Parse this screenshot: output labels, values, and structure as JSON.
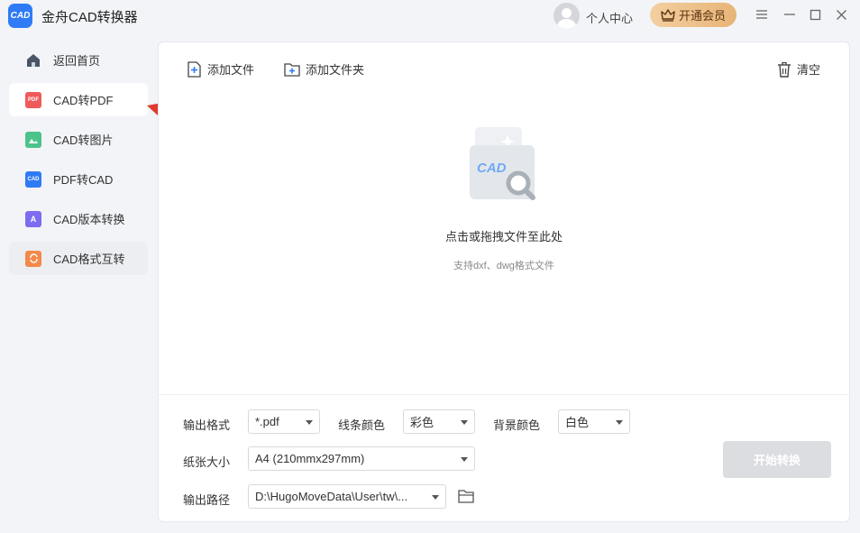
{
  "app": {
    "title": "金舟CAD转换器",
    "logo_text": "CAD"
  },
  "header": {
    "user_center": "个人中心",
    "vip_button": "开通会员"
  },
  "sidebar": {
    "items": [
      {
        "label": "返回首页",
        "icon": "home-icon"
      },
      {
        "label": "CAD转PDF",
        "icon": "pdf-file-icon",
        "badge": "PDF"
      },
      {
        "label": "CAD转图片",
        "icon": "image-file-icon"
      },
      {
        "label": "PDF转CAD",
        "icon": "cad-file-icon",
        "badge": "CAD"
      },
      {
        "label": "CAD版本转换",
        "icon": "version-file-icon",
        "badge": "A"
      },
      {
        "label": "CAD格式互转",
        "icon": "format-file-icon"
      }
    ]
  },
  "toolbar": {
    "add_file": "添加文件",
    "add_folder": "添加文件夹",
    "clear": "清空"
  },
  "drop": {
    "title": "点击或拖拽文件至此处",
    "subtitle": "支持dxf、dwg格式文件",
    "illus_text": "CAD"
  },
  "settings": {
    "output_format_label": "输出格式",
    "output_format_value": "*.pdf",
    "line_color_label": "线条颜色",
    "line_color_value": "彩色",
    "bg_color_label": "背景颜色",
    "bg_color_value": "白色",
    "paper_size_label": "纸张大小",
    "paper_size_value": "A4 (210mmx297mm)",
    "output_path_label": "输出路径",
    "output_path_value": "D:\\HugoMoveData\\User\\tw\\...",
    "start_button": "开始转换"
  },
  "colors": {
    "accent": "#2f7bf5",
    "arrow": "#e23a2e",
    "vip_gold": "#e8b477",
    "disabled_button": "#dcdde0"
  }
}
